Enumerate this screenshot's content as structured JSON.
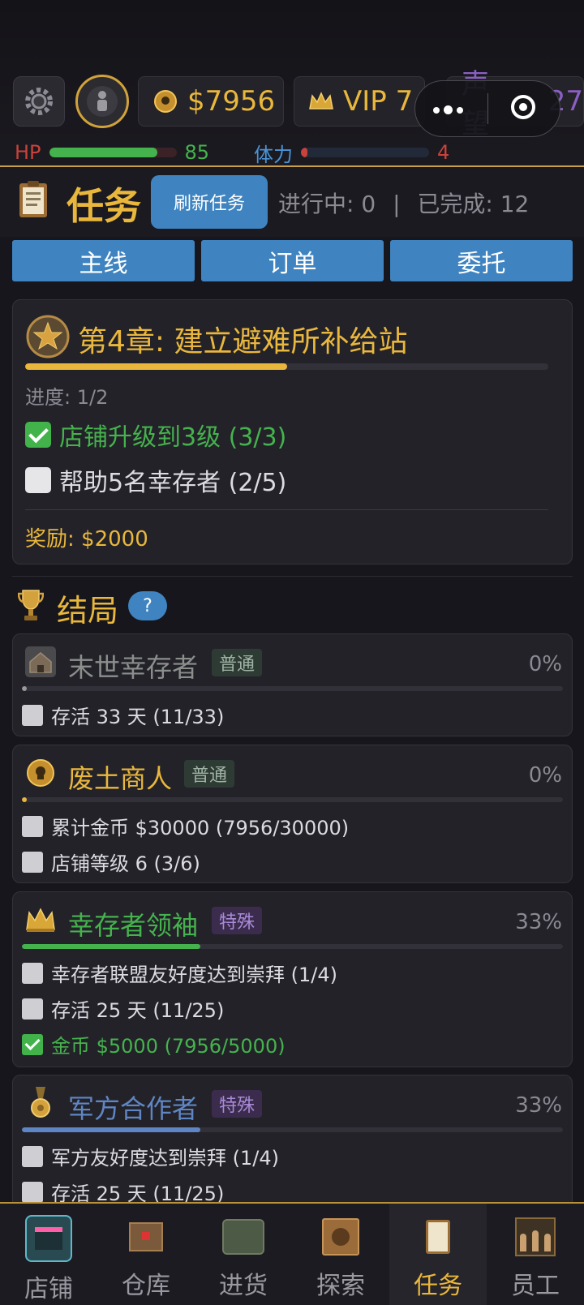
{
  "status_bar": {
    "money": "$7956",
    "vip": "VIP 7",
    "reputation_label": "声望",
    "reputation_value": "27",
    "hp_label": "HP",
    "hp_value": "85",
    "hp_fraction": 0.85,
    "stamina_label": "体力",
    "stamina_value": "4",
    "stamina_fraction": 0.04
  },
  "task_header": {
    "title": "任务",
    "refresh_label": "刷新任务",
    "in_progress": "进行中: 0",
    "separator": "|",
    "completed": "已完成: 12"
  },
  "tabs": [
    "主线",
    "订单",
    "委托"
  ],
  "chapter": {
    "title": "第4章: 建立避难所补给站",
    "progress_text": "进度: 1/2",
    "progress_fraction": 0.5,
    "objectives": [
      {
        "text": "店铺升级到3级 (3/3)",
        "done": true
      },
      {
        "text": "帮助5名幸存者 (2/5)",
        "done": false
      }
    ],
    "reward": "奖励: $2000"
  },
  "endings_section": {
    "title": "结局",
    "help": "?"
  },
  "endings": [
    {
      "name": "末世幸存者",
      "badge": "普通",
      "percent": "0%",
      "progress_fraction": 0.0,
      "name_color": "#8a8f8c",
      "bar_color": "#9a9a9a",
      "icon": "house-icon",
      "conditions": [
        {
          "text": "存活 33 天 (11/33)",
          "done": false
        }
      ]
    },
    {
      "name": "废土商人",
      "badge": "普通",
      "percent": "0%",
      "progress_fraction": 0.0,
      "name_color": "#e9b73c",
      "bar_color": "#e9b73c",
      "icon": "coin-skull-icon",
      "conditions": [
        {
          "text": "累计金币 $30000 (7956/30000)",
          "done": false
        },
        {
          "text": "店铺等级 6 (3/6)",
          "done": false
        }
      ]
    },
    {
      "name": "幸存者领袖",
      "badge": "特殊",
      "percent": "33%",
      "progress_fraction": 0.33,
      "name_color": "#45b34d",
      "bar_color": "#45b34d",
      "icon": "crown-icon",
      "conditions": [
        {
          "text": "幸存者联盟友好度达到崇拜 (1/4)",
          "done": false
        },
        {
          "text": "存活 25 天 (11/25)",
          "done": false
        },
        {
          "text": "金币 $5000 (7956/5000)",
          "done": true
        }
      ]
    },
    {
      "name": "军方合作者",
      "badge": "特殊",
      "percent": "33%",
      "progress_fraction": 0.33,
      "name_color": "#5f86c4",
      "bar_color": "#5f86c4",
      "icon": "medal-icon",
      "conditions": [
        {
          "text": "军方友好度达到崇拜 (1/4)",
          "done": false
        },
        {
          "text": "存活 25 天 (11/25)",
          "done": false
        }
      ]
    }
  ],
  "nav": [
    {
      "label": "店铺",
      "icon": "shop-icon",
      "active": false
    },
    {
      "label": "仓库",
      "icon": "crate-icon",
      "active": false
    },
    {
      "label": "进货",
      "icon": "truck-icon",
      "active": false
    },
    {
      "label": "探索",
      "icon": "map-icon",
      "active": false
    },
    {
      "label": "任务",
      "icon": "clipboard-icon",
      "active": true
    },
    {
      "label": "员工",
      "icon": "team-icon",
      "active": false
    }
  ],
  "colors": {
    "gold": "#e9b73c",
    "blue": "#3f84c0",
    "green": "#42b24a",
    "hp_red": "#c9423c",
    "stamina_blue": "#4a93d6"
  }
}
